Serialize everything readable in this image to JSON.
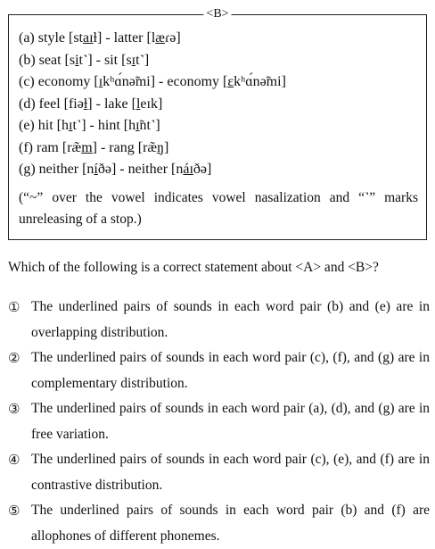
{
  "box": {
    "label": "<B>",
    "items": [
      {
        "tag": "(a)",
        "w1": "style",
        "p1_pre": "[st",
        "p1_seg": "aɪ",
        "p1_post": "ɫ]",
        "dash": "-",
        "w2": "latter",
        "p2_pre": "[l",
        "p2_seg": "æ",
        "p2_post": "ɾə]"
      },
      {
        "tag": "(b)",
        "w1": "seat",
        "p1_pre": "[s",
        "p1_seg": "i",
        "p1_post": "t˺]",
        "dash": "-",
        "w2": "sit",
        "p2_pre": "[s",
        "p2_seg": "ɪ",
        "p2_post": "t˺]"
      },
      {
        "tag": "(c)",
        "w1": "economy",
        "p1_pre": "[",
        "p1_seg": "ɪ",
        "p1_post": "kʰɑ́nə̃mi]",
        "dash": "-",
        "w2": "economy",
        "p2_pre": "[",
        "p2_seg": "ɛ",
        "p2_post": "kʰɑ́nə̃mi]"
      },
      {
        "tag": "(d)",
        "w1": "feel",
        "p1_pre": "[fiə",
        "p1_seg": "ɫ",
        "p1_post": "]",
        "dash": "-",
        "w2": "lake",
        "p2_pre": "[",
        "p2_seg": "l",
        "p2_post": "eɪk]"
      },
      {
        "tag": "(e)",
        "w1": "hit",
        "p1_pre": "[h",
        "p1_seg": "ɪ",
        "p1_post": "t˺]",
        "dash": "-",
        "w2": "hint",
        "p2_pre": "[h",
        "p2_seg": "ɪ̃",
        "p2_post": "nt˺]"
      },
      {
        "tag": "(f)",
        "w1": "ram",
        "p1_pre": "[ræ̃",
        "p1_seg": "m",
        "p1_post": "]",
        "dash": "-",
        "w2": "rang",
        "p2_pre": "[ræ̃",
        "p2_seg": "ŋ",
        "p2_post": "]"
      },
      {
        "tag": "(g)",
        "w1": "neither",
        "p1_pre": "[n",
        "p1_seg": "í",
        "p1_post": "ðə]",
        "dash": "-",
        "w2": "neither",
        "p2_pre": "[n",
        "p2_seg": "áɪ",
        "p2_post": "ðə]"
      }
    ],
    "note": "(“~” over the vowel indicates vowel nasalization and “˺” marks unreleasing of a stop.)"
  },
  "question": "Which of the following is a correct statement about <A> and <B>?",
  "options": [
    {
      "num": "①",
      "text": "The underlined pairs of sounds in each word pair (b) and (e) are in overlapping distribution."
    },
    {
      "num": "②",
      "text": "The underlined pairs of sounds in each word pair (c), (f), and (g) are in complementary distribution."
    },
    {
      "num": "③",
      "text": "The underlined pairs of sounds in each word pair (a), (d), and (g) are in free variation."
    },
    {
      "num": "④",
      "text": "The underlined pairs of sounds in each word pair (c), (e), and (f) are in contrastive distribution."
    },
    {
      "num": "⑤",
      "text": "The underlined pairs of sounds in each word pair (b) and (f) are allophones of different phonemes."
    }
  ]
}
